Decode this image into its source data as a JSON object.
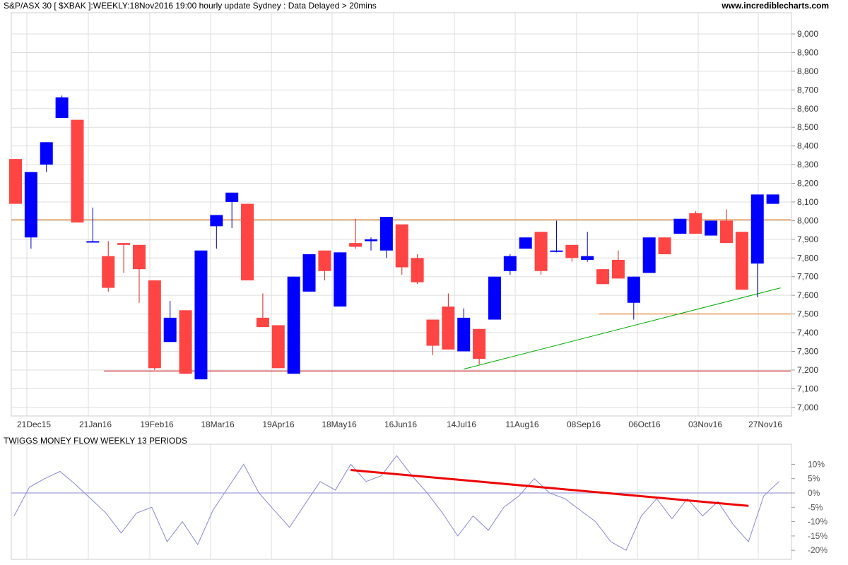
{
  "header": {
    "title": "S&P/ASX 30 [ $XBAK ]:WEEKLY:18Nov2016 19:00 hourly update Sydney : Data Delayed > 20mins",
    "site": "www.incrediblecharts.com"
  },
  "colors": {
    "up": "#0000ff",
    "down": "#ff4444",
    "resistance": "#dd6600",
    "support_low": "#cc0000",
    "trend": "#00aa00",
    "indicator_line": "#8888cc",
    "indicator_trend": "#ee0000",
    "grid": "#dddddd"
  },
  "chart_data": [
    {
      "type": "candlestick",
      "title": "S&P/ASX 30 [ $XBAK ]:WEEKLY:18Nov2016 19:00 hourly update Sydney : Data Delayed > 20mins",
      "ylim": [
        6950,
        9050
      ],
      "y_ticks": [
        "7,000",
        "7,100",
        "7,200",
        "7,300",
        "7,400",
        "7,500",
        "7,600",
        "7,700",
        "7,800",
        "7,900",
        "8,000",
        "8,100",
        "8,200",
        "8,300",
        "8,400",
        "8,500",
        "8,600",
        "8,700",
        "8,800",
        "8,900",
        "9,000"
      ],
      "x_ticks": [
        "21Dec15",
        "21Jan16",
        "19Feb16",
        "18Mar16",
        "19Apr16",
        "18May16",
        "16Jun16",
        "14Jul16",
        "11Aug16",
        "08Sep16",
        "06Oct16",
        "03Nov16",
        "27Nov16"
      ],
      "candles": [
        {
          "o": 8330,
          "h": 8330,
          "l": 8090,
          "c": 8090
        },
        {
          "o": 7910,
          "h": 8260,
          "l": 7850,
          "c": 8260
        },
        {
          "o": 8300,
          "h": 8420,
          "l": 8260,
          "c": 8420
        },
        {
          "o": 8550,
          "h": 8670,
          "l": 8550,
          "c": 8660
        },
        {
          "o": 8540,
          "h": 8540,
          "l": 7990,
          "c": 7990
        },
        {
          "o": 7890,
          "h": 8070,
          "l": 7890,
          "c": 7890
        },
        {
          "o": 7810,
          "h": 7890,
          "l": 7620,
          "c": 7640
        },
        {
          "o": 7880,
          "h": 7880,
          "l": 7720,
          "c": 7870
        },
        {
          "o": 7870,
          "h": 7870,
          "l": 7560,
          "c": 7740
        },
        {
          "o": 7680,
          "h": 7680,
          "l": 7200,
          "c": 7210
        },
        {
          "o": 7350,
          "h": 7570,
          "l": 7350,
          "c": 7480
        },
        {
          "o": 7520,
          "h": 7520,
          "l": 7180,
          "c": 7180
        },
        {
          "o": 7150,
          "h": 7840,
          "l": 7150,
          "c": 7840
        },
        {
          "o": 7970,
          "h": 8030,
          "l": 7850,
          "c": 8030
        },
        {
          "o": 8100,
          "h": 8150,
          "l": 7960,
          "c": 8150
        },
        {
          "o": 8090,
          "h": 8090,
          "l": 7680,
          "c": 7680
        },
        {
          "o": 7480,
          "h": 7610,
          "l": 7430,
          "c": 7430
        },
        {
          "o": 7440,
          "h": 7440,
          "l": 7210,
          "c": 7210
        },
        {
          "o": 7180,
          "h": 7700,
          "l": 7180,
          "c": 7700
        },
        {
          "o": 7620,
          "h": 7820,
          "l": 7620,
          "c": 7820
        },
        {
          "o": 7840,
          "h": 7840,
          "l": 7680,
          "c": 7730
        },
        {
          "o": 7540,
          "h": 7830,
          "l": 7540,
          "c": 7830
        },
        {
          "o": 7880,
          "h": 8010,
          "l": 7850,
          "c": 7860
        },
        {
          "o": 7890,
          "h": 7910,
          "l": 7840,
          "c": 7900
        },
        {
          "o": 7840,
          "h": 8020,
          "l": 7800,
          "c": 8020
        },
        {
          "o": 7980,
          "h": 7980,
          "l": 7710,
          "c": 7750
        },
        {
          "o": 7800,
          "h": 7820,
          "l": 7660,
          "c": 7670
        },
        {
          "o": 7470,
          "h": 7470,
          "l": 7280,
          "c": 7330
        },
        {
          "o": 7540,
          "h": 7610,
          "l": 7310,
          "c": 7310
        },
        {
          "o": 7300,
          "h": 7530,
          "l": 7300,
          "c": 7480
        },
        {
          "o": 7420,
          "h": 7420,
          "l": 7230,
          "c": 7260
        },
        {
          "o": 7470,
          "h": 7700,
          "l": 7470,
          "c": 7700
        },
        {
          "o": 7730,
          "h": 7820,
          "l": 7710,
          "c": 7810
        },
        {
          "o": 7850,
          "h": 7910,
          "l": 7850,
          "c": 7910
        },
        {
          "o": 7940,
          "h": 7940,
          "l": 7710,
          "c": 7730
        },
        {
          "o": 7840,
          "h": 8000,
          "l": 7830,
          "c": 7840
        },
        {
          "o": 7870,
          "h": 7870,
          "l": 7780,
          "c": 7800
        },
        {
          "o": 7790,
          "h": 7940,
          "l": 7780,
          "c": 7810
        },
        {
          "o": 7740,
          "h": 7740,
          "l": 7660,
          "c": 7660
        },
        {
          "o": 7790,
          "h": 7840,
          "l": 7690,
          "c": 7690
        },
        {
          "o": 7560,
          "h": 7700,
          "l": 7470,
          "c": 7700
        },
        {
          "o": 7720,
          "h": 7910,
          "l": 7720,
          "c": 7910
        },
        {
          "o": 7910,
          "h": 7910,
          "l": 7820,
          "c": 7820
        },
        {
          "o": 7930,
          "h": 8010,
          "l": 7930,
          "c": 8010
        },
        {
          "o": 8040,
          "h": 8050,
          "l": 7930,
          "c": 7930
        },
        {
          "o": 7920,
          "h": 8000,
          "l": 7920,
          "c": 8000
        },
        {
          "o": 8000,
          "h": 8060,
          "l": 7880,
          "c": 7880
        },
        {
          "o": 7940,
          "h": 7940,
          "l": 7630,
          "c": 7630
        },
        {
          "o": 7770,
          "h": 8140,
          "l": 7590,
          "c": 8140
        },
        {
          "o": 8090,
          "h": 8140,
          "l": 8090,
          "c": 8140
        }
      ],
      "horizontal_lines": [
        {
          "y": 8005,
          "from_candle": 0,
          "to_candle": 49,
          "color": "resistance"
        },
        {
          "y": 7500,
          "from_candle": 38,
          "to_candle": 49,
          "color": "resistance"
        },
        {
          "y": 7195,
          "from_candle": 6,
          "to_candle": 49,
          "color": "support_low"
        }
      ],
      "trendline": {
        "from": {
          "candle": 29,
          "y": 7205
        },
        "to": {
          "candle": 49.5,
          "y": 7640
        }
      }
    },
    {
      "type": "line",
      "title": "TWIGGS MONEY FLOW WEEKLY 13 PERIODS",
      "ylim": [
        -22,
        15
      ],
      "y_ticks": [
        "10%",
        "5%",
        "0%",
        "-5%",
        "-10%",
        "-15%",
        "-20%"
      ],
      "y_tick_values": [
        10,
        5,
        0,
        -5,
        -10,
        -15,
        -20
      ],
      "values": [
        -8,
        2,
        5,
        7.5,
        3,
        -2,
        -7,
        -14,
        -7,
        -5,
        -17,
        -10,
        -18,
        -6,
        2,
        10,
        0,
        -6,
        -12,
        -4,
        4,
        1,
        10,
        4,
        6,
        13,
        6,
        0,
        -7,
        -15,
        -8,
        -13,
        -5,
        -1,
        5,
        0,
        -2,
        -6,
        -10,
        -17,
        -20,
        -8,
        -2,
        -9,
        -2,
        -8,
        -3,
        -11,
        -17,
        -1,
        4
      ],
      "trendline": {
        "from": {
          "index": 22,
          "y": 8
        },
        "to": {
          "index": 48,
          "y": -4.5
        }
      }
    }
  ]
}
